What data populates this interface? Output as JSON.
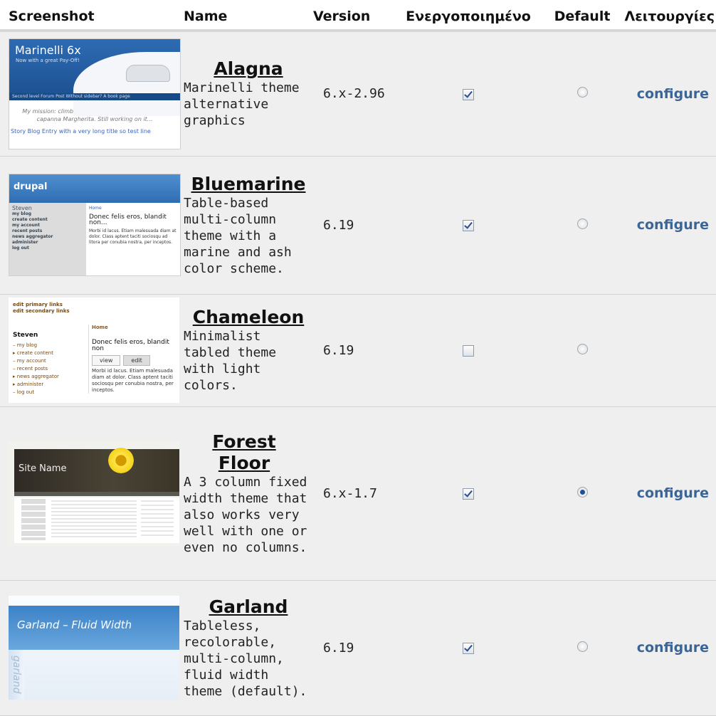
{
  "headers": {
    "screenshot": "Screenshot",
    "name": "Name",
    "version": "Version",
    "enabled": "Ενεργοποιημένο",
    "default": "Default",
    "operations": "Λειτουργίες"
  },
  "themes": [
    {
      "name": "Alagna",
      "description": "Marinelli theme alternative graphics",
      "version": "6.x-2.96",
      "enabled": true,
      "default": false,
      "operation": "configure",
      "thumb": {
        "title": "Marinelli 6x",
        "subtitle": "Now with a great Pay-Off!",
        "nav": "Second level  Forum Post  Without sidebar?  A book page",
        "text": "My mission: climb Dufourspitze and get married at capanna Margherita. Still working on it...",
        "link": "Story Blog Entry with a very long title so test line"
      }
    },
    {
      "name": "Bluemarine",
      "description": "Table-based multi-column theme with a marine and ash color scheme.",
      "version": "6.19",
      "enabled": true,
      "default": false,
      "operation": "configure",
      "thumb": {
        "logo": "drupal",
        "user": "Steven",
        "menu": "my blog\ncreate content\nmy account\nrecent posts\nnews aggregator\nadminister\nlog out",
        "home": "Home",
        "title": "Donec felis eros, blandit non...",
        "body": "Morbi id lacus. Etiam malesuada diam at dolor. Class aptent taciti sociosqu ad litora per conubia nostra, per inceptos."
      }
    },
    {
      "name": "Chameleon",
      "description": "Minimalist tabled theme with light colors.",
      "version": "6.19",
      "enabled": false,
      "default": false,
      "operation": "",
      "thumb": {
        "links1": "edit primary links",
        "links2": "edit secondary links",
        "user": "Steven",
        "menu": "– my blog\n▸ create content\n– my account\n– recent posts\n▸ news aggregator\n▸ administer\n– log out",
        "home": "Home",
        "title": "Donec felis eros, blandit non",
        "tab_view": "view",
        "tab_edit": "edit",
        "body": "Morbi id lacus. Etiam malesuada diam at dolor. Class aptent taciti sociosqu per conubia nostra, per inceptos."
      }
    },
    {
      "name": "Forest Floor",
      "description": "A 3 column fixed width theme that also works very well with one or even no columns.",
      "version": "6.x-1.7",
      "enabled": true,
      "default": true,
      "operation": "configure",
      "thumb": {
        "site": "Site Name"
      }
    },
    {
      "name": "Garland",
      "description": "Tableless, recolorable, multi-column, fluid width theme (default).",
      "version": "6.19",
      "enabled": true,
      "default": false,
      "operation": "configure",
      "thumb": {
        "title": "Garland – Fluid Width",
        "side": "garland"
      }
    }
  ]
}
